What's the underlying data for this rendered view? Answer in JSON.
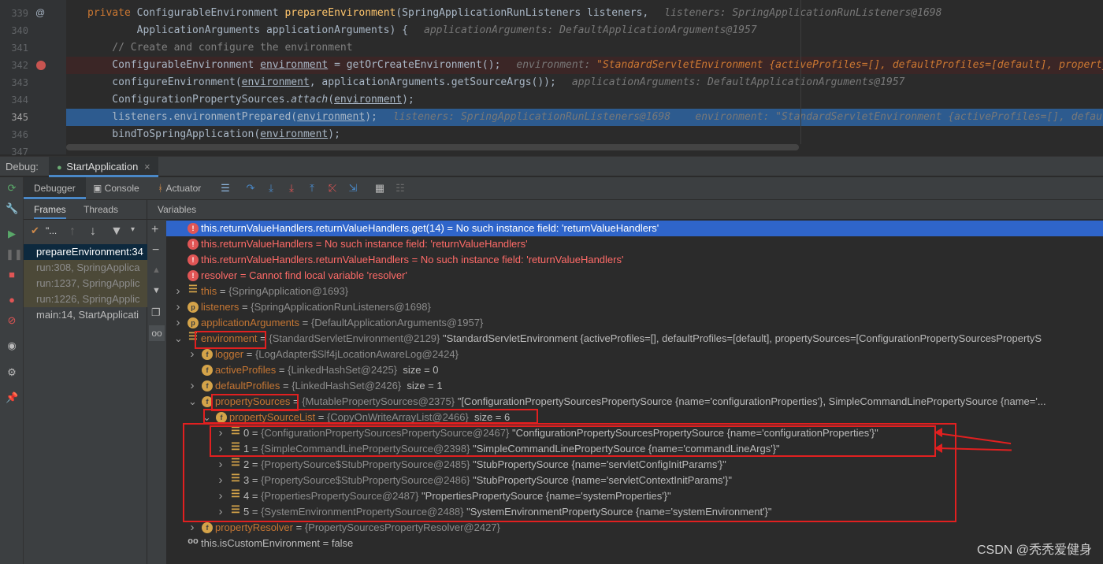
{
  "editor": {
    "lines": [
      {
        "num": "339",
        "marker": "@",
        "parts": [
          [
            "kw",
            "private "
          ],
          [
            "",
            "ConfigurableEnvironment "
          ],
          [
            "fn",
            "prepareEnvironment"
          ],
          [
            "",
            "(SpringApplicationRunListeners listeners,"
          ],
          [
            "hint",
            "listeners: SpringApplicationRunListeners@1698"
          ]
        ]
      },
      {
        "num": "340",
        "marker": "",
        "parts": [
          [
            "",
            "        ApplicationArguments applicationArguments) {"
          ],
          [
            "hint",
            "applicationArguments: DefaultApplicationArguments@1957"
          ]
        ]
      },
      {
        "num": "341",
        "marker": "",
        "parts": [
          [
            "cm",
            "    // Create and configure the environment"
          ]
        ]
      },
      {
        "num": "342",
        "marker": "breakpoint",
        "parts": [
          [
            "",
            "    ConfigurableEnvironment "
          ],
          [
            "ul",
            "environment"
          ],
          [
            "",
            " = getOrCreateEnvironment();"
          ],
          [
            "hint",
            "environment: "
          ],
          [
            "hintstr",
            "\"StandardServletEnvironment {activeProfiles=[], defaultProfiles=[default], property"
          ]
        ]
      },
      {
        "num": "343",
        "marker": "",
        "parts": [
          [
            "",
            "    configureEnvironment("
          ],
          [
            "ul",
            "environment"
          ],
          [
            "",
            ", applicationArguments.getSourceArgs());"
          ],
          [
            "hint",
            "applicationArguments: DefaultApplicationArguments@1957"
          ]
        ]
      },
      {
        "num": "344",
        "marker": "",
        "parts": [
          [
            "",
            "    ConfigurationPropertySources."
          ],
          [
            "it",
            "attach"
          ],
          [
            "",
            "("
          ],
          [
            "ul",
            "environment"
          ],
          [
            "",
            ");"
          ]
        ]
      },
      {
        "num": "345",
        "marker": "current",
        "parts": [
          [
            "",
            "    listeners.environmentPrepared("
          ],
          [
            "ul",
            "environment"
          ],
          [
            "",
            ");"
          ],
          [
            "hint",
            "listeners: SpringApplicationRunListeners@1698    environment: \"StandardServletEnvironment {activeProfiles=[], defaul"
          ]
        ]
      },
      {
        "num": "346",
        "marker": "",
        "parts": [
          [
            "",
            "    bindToSpringApplication("
          ],
          [
            "ul",
            "environment"
          ],
          [
            "",
            ");"
          ]
        ]
      },
      {
        "num": "347",
        "marker": "",
        "parts": [
          [
            "",
            ""
          ]
        ]
      }
    ]
  },
  "debug": {
    "label": "Debug:",
    "session_tab": "StartApplication",
    "close": "×"
  },
  "toolbar": {
    "tabs": [
      "Debugger",
      "Console",
      "Actuator"
    ]
  },
  "frames": {
    "tabs": [
      "Frames",
      "Threads"
    ],
    "thread_label": "\"...",
    "items": [
      {
        "text": "prepareEnvironment:34",
        "style": "sel"
      },
      {
        "text": "run:308, SpringApplica",
        "style": "lib"
      },
      {
        "text": "run:1237, SpringApplic",
        "style": "lib"
      },
      {
        "text": "run:1226, SpringApplic",
        "style": "lib"
      },
      {
        "text": "main:14, StartApplicati",
        "style": ""
      }
    ]
  },
  "variables": {
    "header": "Variables",
    "rows": [
      {
        "indent": 0,
        "arrow": "",
        "icon": "err",
        "name": "this.returnValueHandlers.returnValueHandlers.get(14)",
        "eq": " = ",
        "type": "",
        "value": "No such instance field: 'returnValueHandlers'",
        "vclass": "t-white",
        "nameclass": "t-white",
        "sel": true
      },
      {
        "indent": 0,
        "arrow": "",
        "icon": "err",
        "name": "this.returnValueHandlers",
        "eq": " = ",
        "type": "",
        "value": "No such instance field: 'returnValueHandlers'",
        "vclass": "t-err",
        "nameclass": "t-err"
      },
      {
        "indent": 0,
        "arrow": "",
        "icon": "err",
        "name": "this.returnValueHandlers.returnValueHandlers",
        "eq": " = ",
        "type": "",
        "value": "No such instance field: 'returnValueHandlers'",
        "vclass": "t-err",
        "nameclass": "t-err"
      },
      {
        "indent": 0,
        "arrow": "",
        "icon": "err",
        "name": "resolver",
        "eq": " = ",
        "type": "",
        "value": "Cannot find local variable 'resolver'",
        "vclass": "t-err",
        "nameclass": "t-err"
      },
      {
        "indent": 0,
        "arrow": ">",
        "icon": "lines",
        "name": "this",
        "eq": " = ",
        "type": "{SpringApplication@1693}",
        "value": "",
        "vclass": "t-white",
        "nameclass": "nm"
      },
      {
        "indent": 0,
        "arrow": ">",
        "icon": "p",
        "name": "listeners",
        "eq": " = ",
        "type": "{SpringApplicationRunListeners@1698}",
        "value": "",
        "vclass": "t-white",
        "nameclass": "nm"
      },
      {
        "indent": 0,
        "arrow": ">",
        "icon": "p",
        "name": "applicationArguments",
        "eq": " = ",
        "type": "{DefaultApplicationArguments@1957}",
        "value": "",
        "vclass": "t-white",
        "nameclass": "nm"
      },
      {
        "indent": 0,
        "arrow": "v",
        "icon": "lines",
        "name": "environment",
        "eq": " = ",
        "type": "{StandardServletEnvironment@2129}",
        "value": " \"StandardServletEnvironment {activeProfiles=[], defaultProfiles=[default], propertySources=[ConfigurationPropertySourcesPropertyS",
        "vclass": "t-white",
        "nameclass": "nm"
      },
      {
        "indent": 1,
        "arrow": ">",
        "icon": "f",
        "name": "logger",
        "eq": " = ",
        "type": "{LogAdapter$Slf4jLocationAwareLog@2424}",
        "value": "",
        "vclass": "t-white",
        "nameclass": "nm"
      },
      {
        "indent": 1,
        "arrow": "",
        "icon": "f",
        "name": "activeProfiles",
        "eq": " = ",
        "type": "{LinkedHashSet@2425}",
        "value": "  size = 0",
        "vclass": "t-white",
        "nameclass": "nm"
      },
      {
        "indent": 1,
        "arrow": ">",
        "icon": "f",
        "name": "defaultProfiles",
        "eq": " = ",
        "type": "{LinkedHashSet@2426}",
        "value": "  size = 1",
        "vclass": "t-white",
        "nameclass": "nm"
      },
      {
        "indent": 1,
        "arrow": "v",
        "icon": "f",
        "name": "propertySources",
        "eq": " = ",
        "type": "{MutablePropertySources@2375}",
        "value": " \"[ConfigurationPropertySourcesPropertySource {name='configurationProperties'}, SimpleCommandLinePropertySource {name='...",
        "vclass": "t-white",
        "nameclass": "nm"
      },
      {
        "indent": 2,
        "arrow": "v",
        "icon": "f",
        "name": "propertySourceList",
        "eq": " = ",
        "type": "{CopyOnWriteArrayList@2466}",
        "value": "  size = 6",
        "vclass": "t-white",
        "nameclass": "nm"
      },
      {
        "indent": 3,
        "arrow": ">",
        "icon": "lines",
        "name": "0",
        "eq": " = ",
        "type": "{ConfigurationPropertySourcesPropertySource@2467}",
        "value": " \"ConfigurationPropertySourcesPropertySource {name='configurationProperties'}\"",
        "vclass": "t-white",
        "nameclass": "t-white"
      },
      {
        "indent": 3,
        "arrow": ">",
        "icon": "lines",
        "name": "1",
        "eq": " = ",
        "type": "{SimpleCommandLinePropertySource@2398}",
        "value": " \"SimpleCommandLinePropertySource {name='commandLineArgs'}\"",
        "vclass": "t-white",
        "nameclass": "t-white"
      },
      {
        "indent": 3,
        "arrow": ">",
        "icon": "lines",
        "name": "2",
        "eq": " = ",
        "type": "{PropertySource$StubPropertySource@2485}",
        "value": " \"StubPropertySource {name='servletConfigInitParams'}\"",
        "vclass": "t-white",
        "nameclass": "t-white"
      },
      {
        "indent": 3,
        "arrow": ">",
        "icon": "lines",
        "name": "3",
        "eq": " = ",
        "type": "{PropertySource$StubPropertySource@2486}",
        "value": " \"StubPropertySource {name='servletContextInitParams'}\"",
        "vclass": "t-white",
        "nameclass": "t-white"
      },
      {
        "indent": 3,
        "arrow": ">",
        "icon": "lines",
        "name": "4",
        "eq": " = ",
        "type": "{PropertiesPropertySource@2487}",
        "value": " \"PropertiesPropertySource {name='systemProperties'}\"",
        "vclass": "t-white",
        "nameclass": "t-white"
      },
      {
        "indent": 3,
        "arrow": ">",
        "icon": "lines",
        "name": "5",
        "eq": " = ",
        "type": "{SystemEnvironmentPropertySource@2488}",
        "value": " \"SystemEnvironmentPropertySource {name='systemEnvironment'}\"",
        "vclass": "t-white",
        "nameclass": "t-white"
      },
      {
        "indent": 1,
        "arrow": ">",
        "icon": "f",
        "name": "propertyResolver",
        "eq": " = ",
        "type": "{PropertySourcesPropertyResolver@2427}",
        "value": "",
        "vclass": "t-white",
        "nameclass": "nm"
      },
      {
        "indent": 0,
        "arrow": "",
        "icon": "oo",
        "name": "this.isCustomEnvironment",
        "eq": " = ",
        "type": "",
        "value": "false",
        "vclass": "t-white",
        "nameclass": "t-white"
      }
    ]
  },
  "watermark": "CSDN @秃秃爱健身",
  "colors": {
    "annotation": "#e12020",
    "selection": "#2f65ca",
    "current_line": "#2d5b8f"
  }
}
